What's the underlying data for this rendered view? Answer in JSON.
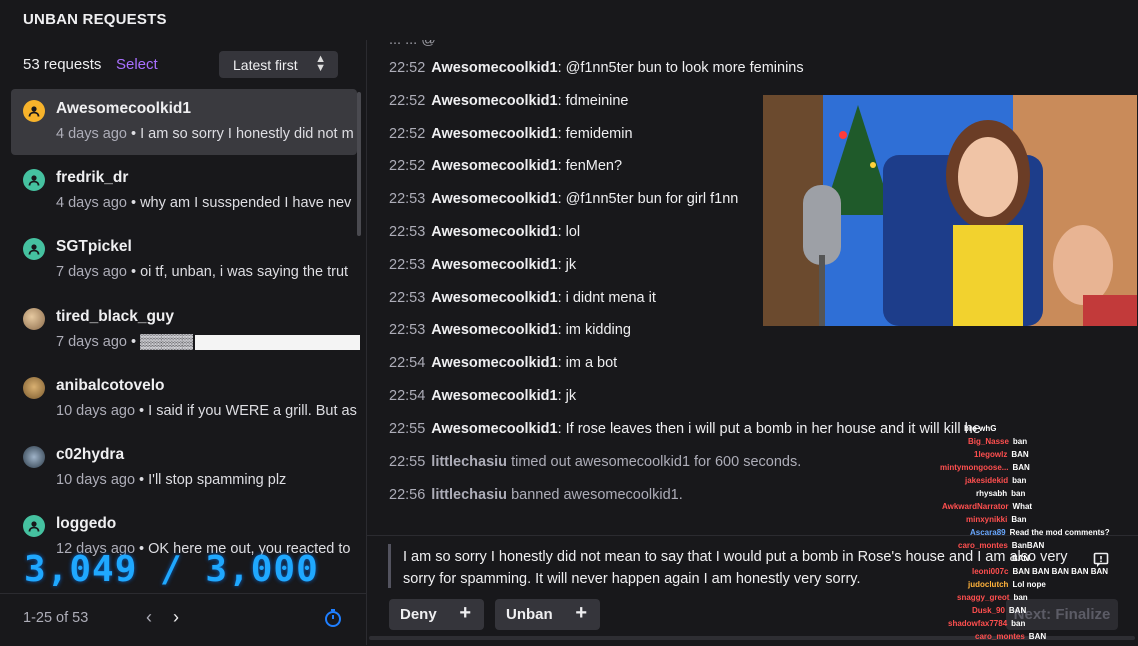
{
  "header": {
    "title": "UNBAN REQUESTS"
  },
  "left": {
    "count_label": "53 requests",
    "select_label": "Select",
    "sort_label": "Latest first",
    "requests": [
      {
        "user": "Awesomecoolkid1",
        "ago": "4 days ago",
        "text": " • I am so sorry I honestly did not m",
        "avatar_color": "#f7b32b",
        "avatar_glyph": "person-icon"
      },
      {
        "user": "fredrik_dr",
        "ago": "4 days ago",
        "text": " • why am I susspended I have nev",
        "avatar_color": "#45c1a0",
        "avatar_glyph": "person-icon"
      },
      {
        "user": "SGTpickel",
        "ago": "7 days ago",
        "text": " • oi tf, unban, i was saying the trut",
        "avatar_color": "#45c1a0",
        "avatar_glyph": "person-icon"
      },
      {
        "user": "tired_black_guy",
        "ago": "7 days ago",
        "text": " • ▓▓▓▓▓",
        "avatar_color": "#c9a37b",
        "avatar_glyph": "photo-avatar"
      },
      {
        "user": "anibalcotovelo",
        "ago": "10 days ago",
        "text": " • I said if you WERE a grill. But as",
        "avatar_color": "#b8894e",
        "avatar_glyph": "photo-avatar"
      },
      {
        "user": "c02hydra",
        "ago": "10 days ago",
        "text": " • I'll stop spamming plz",
        "avatar_color": "#3a4a5a",
        "avatar_glyph": "photo-avatar"
      },
      {
        "user": "loggedo",
        "ago": "12 days ago",
        "text": " • OK here me out, you reacted to",
        "avatar_color": "#45c1a0",
        "avatar_glyph": "person-icon"
      }
    ],
    "overlay_counter": "3,049 / 3,000",
    "pager_label": "1-25 of 53"
  },
  "chat": {
    "partial_top": "... ... @",
    "messages": [
      {
        "time": "22:52",
        "user": "Awesomecoolkid1",
        "text": ": @f1nn5ter bun to look more feminins",
        "kind": "user"
      },
      {
        "time": "22:52",
        "user": "Awesomecoolkid1",
        "text": ": fdmeinine",
        "kind": "user"
      },
      {
        "time": "22:52",
        "user": "Awesomecoolkid1",
        "text": ": femidemin",
        "kind": "user"
      },
      {
        "time": "22:52",
        "user": "Awesomecoolkid1",
        "text": ": fenMen?",
        "kind": "user"
      },
      {
        "time": "22:53",
        "user": "Awesomecoolkid1",
        "text": ": @f1nn5ter bun for girl f1nn",
        "kind": "user"
      },
      {
        "time": "22:53",
        "user": "Awesomecoolkid1",
        "text": ": lol",
        "kind": "user"
      },
      {
        "time": "22:53",
        "user": "Awesomecoolkid1",
        "text": ": jk",
        "kind": "user"
      },
      {
        "time": "22:53",
        "user": "Awesomecoolkid1",
        "text": ": i didnt mena it",
        "kind": "user"
      },
      {
        "time": "22:53",
        "user": "Awesomecoolkid1",
        "text": ": im kidding",
        "kind": "user"
      },
      {
        "time": "22:54",
        "user": "Awesomecoolkid1",
        "text": ": im a bot",
        "kind": "user"
      },
      {
        "time": "22:54",
        "user": "Awesomecoolkid1",
        "text": ": jk",
        "kind": "user"
      },
      {
        "time": "22:55",
        "user": "Awesomecoolkid1",
        "text": ": If rose leaves then i will put a bomb in her house and it will kill he",
        "kind": "user"
      },
      {
        "time": "22:55",
        "user": "littlechasiu",
        "text": " timed out awesomecoolkid1 for 600 seconds.",
        "kind": "mod"
      },
      {
        "time": "22:56",
        "user": "littlechasiu",
        "text": " banned awesomecoolkid1.",
        "kind": "mod"
      }
    ]
  },
  "composer": {
    "reason": "I am so sorry I honestly did not mean to say that I would put a bomb in Rose's house and I am also very sorry for spamming. It will never happen again I am honestly very sorry.",
    "deny_label": "Deny",
    "unban_label": "Unban",
    "finalize_label": "Next: Finalize"
  },
  "stream_chat_overlay": [
    {
      "name": "",
      "text": "bro whG"
    },
    {
      "name": "Big_Nasse",
      "text": "ban"
    },
    {
      "name": "1legowlz",
      "text": "BAN"
    },
    {
      "name": "mintymongoose...",
      "text": "BAN"
    },
    {
      "name": "jakesidekid",
      "text": "ban"
    },
    {
      "name": "rhysabh",
      "text": "ban"
    },
    {
      "name": "AwkwardNarrator",
      "text": "What"
    },
    {
      "name": "minxynikki",
      "text": "Ban"
    },
    {
      "name": "Ascara89",
      "text": "Read the mod comments?"
    },
    {
      "name": "caro_montes",
      "text": "BanBAN"
    },
    {
      "name": "",
      "text": "BAN"
    },
    {
      "name": "leoni007c",
      "text": "BAN BAN BAN BAN BAN"
    },
    {
      "name": "judoclutch",
      "text": "Lol nope"
    },
    {
      "name": "snaggy_greot",
      "text": "ban"
    },
    {
      "name": "Dusk_90",
      "text": "BAN"
    },
    {
      "name": "shadowfax7784",
      "text": "ban"
    },
    {
      "name": "caro_montes",
      "text": "BAN"
    }
  ],
  "colors": {
    "accent": "#a970ff",
    "background": "#18181b",
    "panel_selected": "#3a3a3f",
    "button": "#35353b"
  }
}
